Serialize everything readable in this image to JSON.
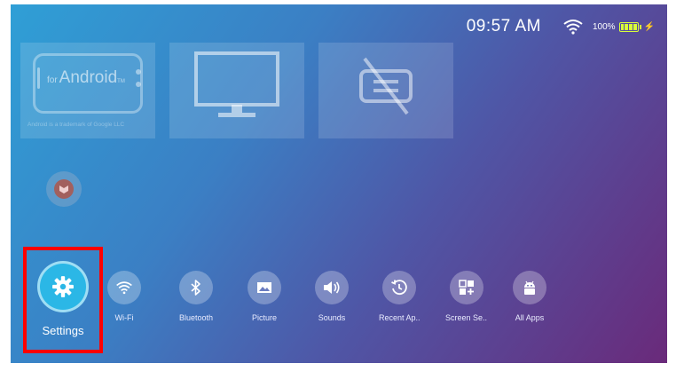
{
  "status_bar": {
    "time": "09:57 AM",
    "battery_percent": "100%",
    "battery_level": 1.0
  },
  "tiles": {
    "android": {
      "prefix": "for",
      "word": "Android",
      "trademark": "TM",
      "legal": "Android is a trademark of Google LLC"
    }
  },
  "dock": {
    "settings": "Settings",
    "items": [
      {
        "label": "Wi-Fi",
        "icon": "wifi-icon"
      },
      {
        "label": "Bluetooth",
        "icon": "bluetooth-icon"
      },
      {
        "label": "Picture",
        "icon": "picture-icon"
      },
      {
        "label": "Sounds",
        "icon": "sounds-icon"
      },
      {
        "label": "Recent Ap..",
        "icon": "recent-apps-icon"
      },
      {
        "label": "Screen Se..",
        "icon": "screen-settings-icon"
      },
      {
        "label": "All Apps",
        "icon": "all-apps-icon"
      }
    ]
  },
  "colors": {
    "highlight": "#ff0000",
    "accent": "#2bb7e6",
    "battery": "#d9ff3a"
  }
}
